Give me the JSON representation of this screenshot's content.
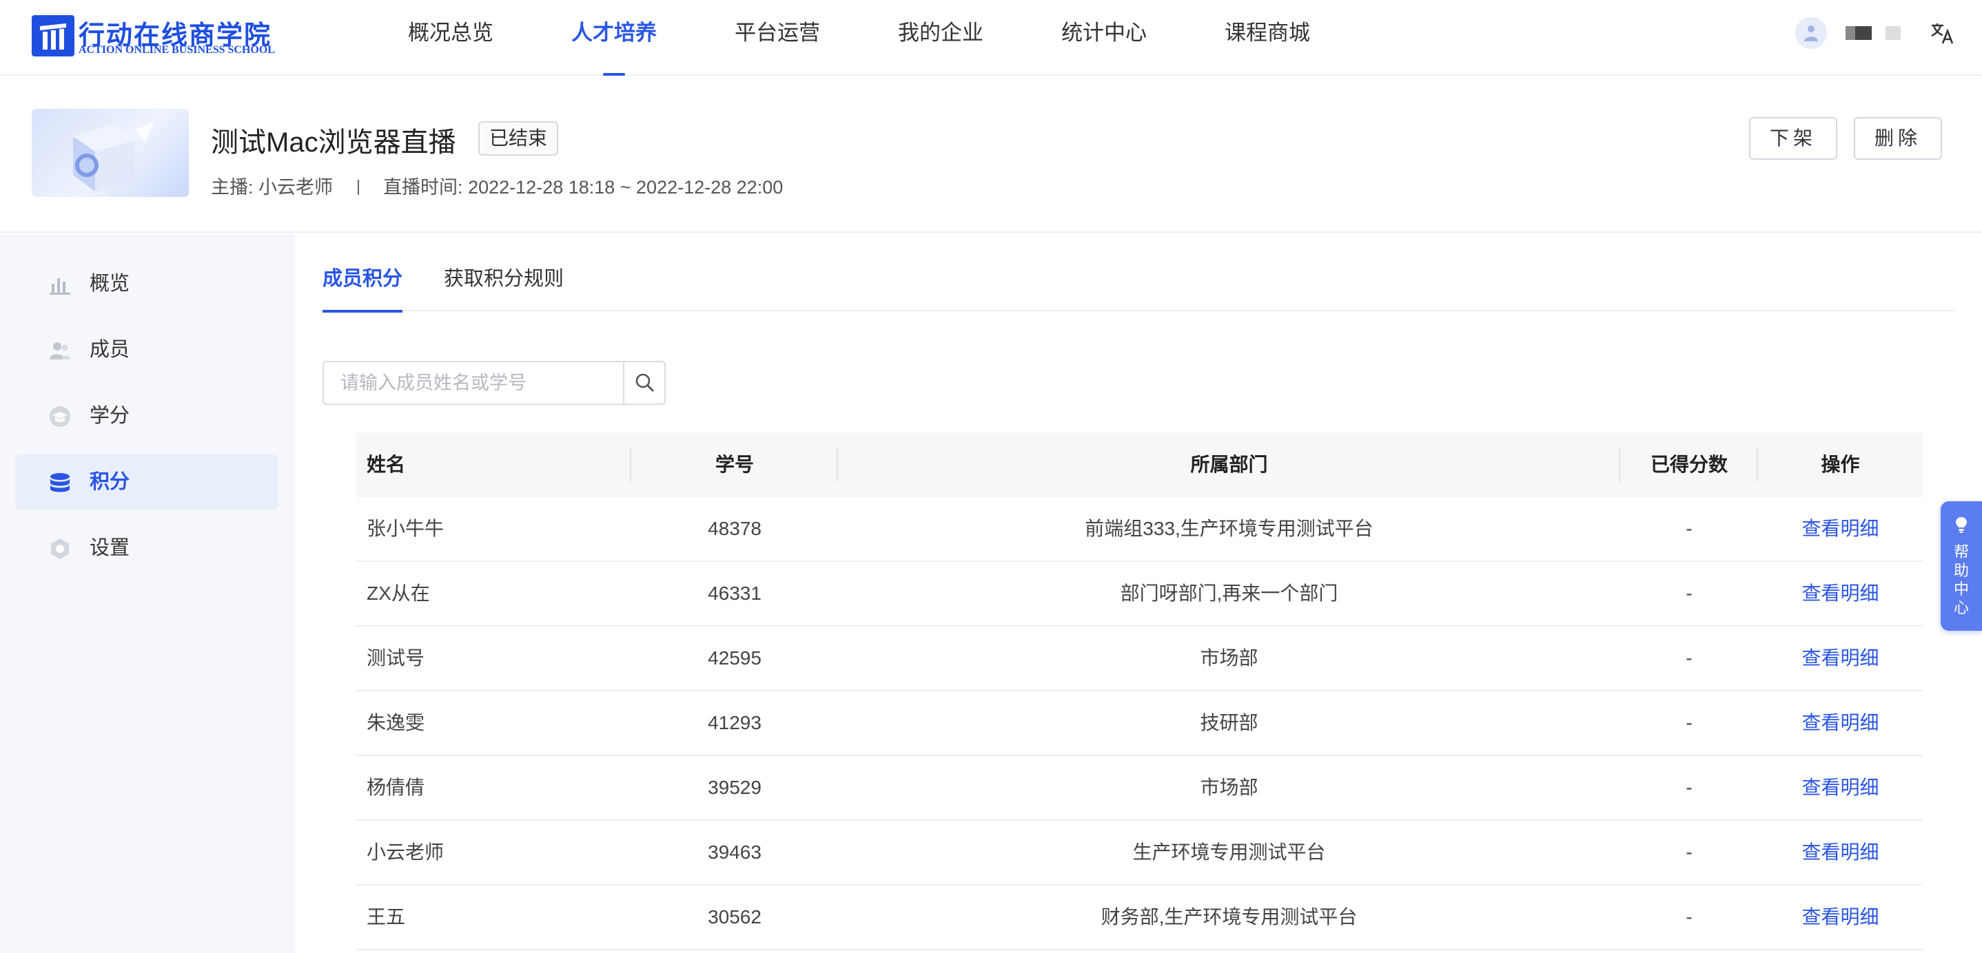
{
  "brand": {
    "name_cn": "行动在线商学院",
    "name_en": "ACTION ONLINE BUSINESS SCHOOL",
    "color": "#1f4fe0"
  },
  "nav": {
    "items": [
      "概况总览",
      "人才培养",
      "平台运营",
      "我的企业",
      "统计中心",
      "课程商城"
    ],
    "active_index": 1
  },
  "header_icons": [
    "avatar-icon",
    "translate-icon"
  ],
  "course": {
    "title": "测试Mac浏览器直播",
    "status": "已结束",
    "host_label": "主播:",
    "host": "小云老师",
    "time_label": "直播时间:",
    "time": "2022-12-28 18:18 ~ 2022-12-28 22:00",
    "actions": {
      "unpublish": "下架",
      "delete": "删除"
    }
  },
  "sidebar": {
    "items": [
      {
        "label": "概览",
        "icon": "bar-chart-icon"
      },
      {
        "label": "成员",
        "icon": "users-icon"
      },
      {
        "label": "学分",
        "icon": "graduation-cap-icon"
      },
      {
        "label": "积分",
        "icon": "coin-stack-icon"
      },
      {
        "label": "设置",
        "icon": "gear-icon"
      }
    ],
    "active_index": 3
  },
  "tabs": {
    "items": [
      "成员积分",
      "获取积分规则"
    ],
    "active_index": 0
  },
  "search": {
    "placeholder": "请输入成员姓名或学号",
    "value": ""
  },
  "table": {
    "columns": [
      "姓名",
      "学号",
      "所属部门",
      "已得分数",
      "操作"
    ],
    "rows": [
      {
        "name": "张小牛牛",
        "id": "48378",
        "dept": "前端组333,生产环境专用测试平台",
        "score": "-",
        "action": "查看明细"
      },
      {
        "name": "ZX从在",
        "id": "46331",
        "dept": "部门呀部门,再来一个部门",
        "score": "-",
        "action": "查看明细"
      },
      {
        "name": "测试号",
        "id": "42595",
        "dept": "市场部",
        "score": "-",
        "action": "查看明细"
      },
      {
        "name": "朱逸雯",
        "id": "41293",
        "dept": "技研部",
        "score": "-",
        "action": "查看明细"
      },
      {
        "name": "杨倩倩",
        "id": "39529",
        "dept": "市场部",
        "score": "-",
        "action": "查看明细"
      },
      {
        "name": "小云老师",
        "id": "39463",
        "dept": "生产环境专用测试平台",
        "score": "-",
        "action": "查看明细"
      },
      {
        "name": "王五",
        "id": "30562",
        "dept": "财务部,生产环境专用测试平台",
        "score": "-",
        "action": "查看明细"
      }
    ]
  },
  "help": {
    "label": "帮助中心",
    "chars": [
      "帮",
      "助",
      "中",
      "心"
    ]
  },
  "colors": {
    "accent": "#2a55e5",
    "sidebar_bg": "#f5f7fb",
    "help_bg": "#5b7df0"
  }
}
